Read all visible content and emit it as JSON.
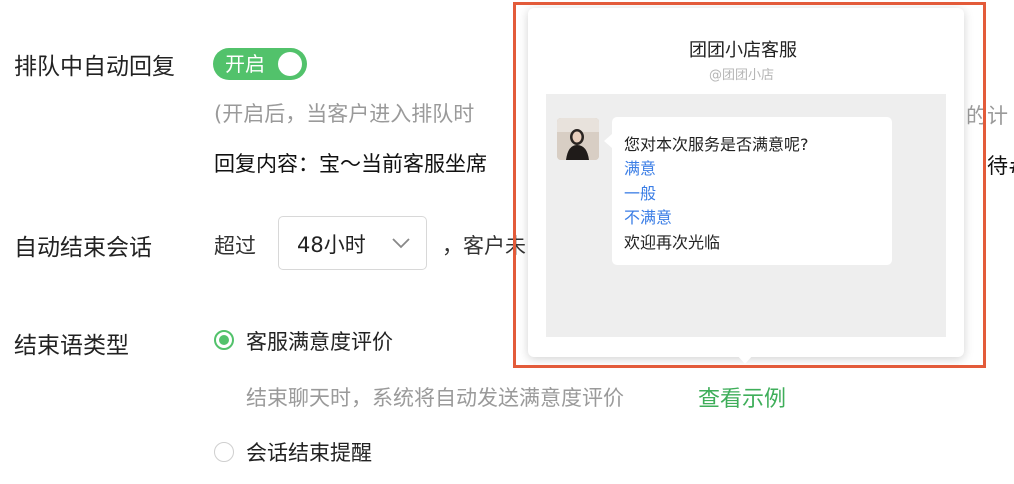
{
  "settings": {
    "queue_reply": {
      "label": "排队中自动回复",
      "toggle_label": "开启",
      "note": "(开启后，当客户进入排队时",
      "note_tail": "的计",
      "content_prefix": "回复内容：",
      "content_text": "宝～当前客服坐席",
      "content_tail": "待#"
    },
    "auto_end": {
      "label": "自动结束会话",
      "prefix": "超过",
      "select_value": "48小时",
      "suffix": "，客户未"
    },
    "end_type": {
      "label": "结束语类型",
      "options": [
        "客服满意度评价",
        "会话结束提醒"
      ],
      "selected": "客服满意度评价",
      "hint": "结束聊天时，系统将自动发送满意度评价",
      "example_link": "查看示例"
    }
  },
  "popup": {
    "title": "团团小店客服",
    "subtitle": "@团团小店",
    "message": {
      "question": "您对本次服务是否满意呢?",
      "choices": [
        "满意",
        "一般",
        "不满意"
      ],
      "closing": "欢迎再次光临"
    }
  },
  "colors": {
    "accent_green": "#52c26b",
    "link_blue": "#3b7ee6",
    "highlight_red": "#e35b3a"
  }
}
